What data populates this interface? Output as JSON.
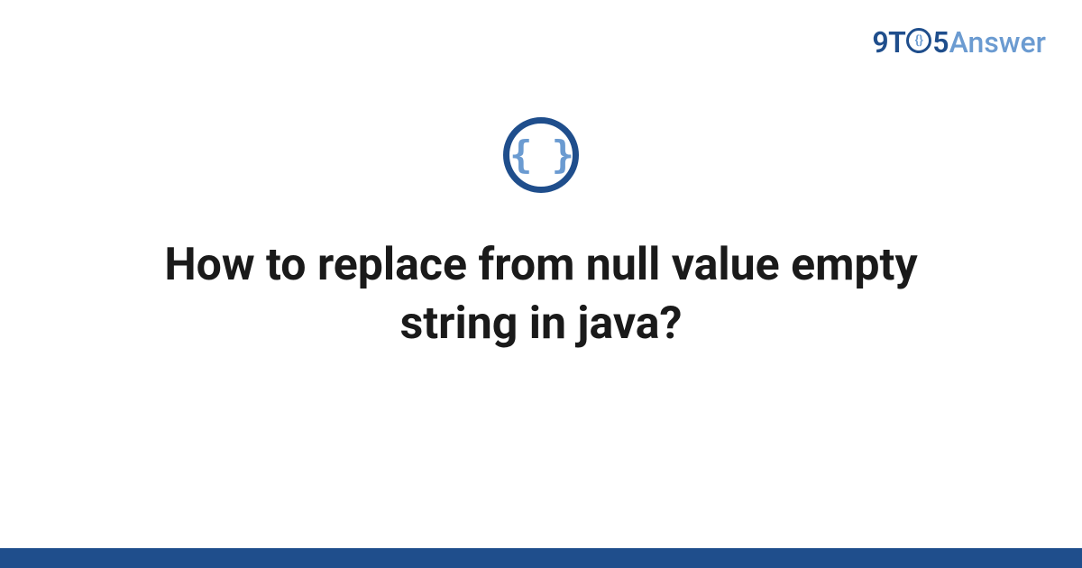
{
  "header": {
    "logo_prefix": "9T",
    "logo_o_inner": "{}",
    "logo_suffix": "5",
    "logo_word": "Answer"
  },
  "main": {
    "icon_braces": "{ }",
    "title": "How to replace from null value empty string in java?"
  }
}
